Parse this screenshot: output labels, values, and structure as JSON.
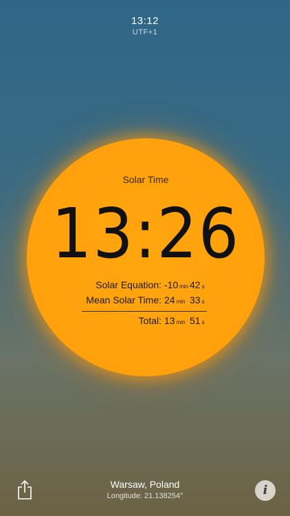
{
  "top": {
    "time": "13:12",
    "timezone": "UTF+1"
  },
  "sun": {
    "label": "Solar Time",
    "time": "13:26",
    "rows": [
      {
        "label": "Solar Equation:",
        "minutes": "-10",
        "min_unit": "min",
        "seconds": "42",
        "sec_unit": "s"
      },
      {
        "label": "Mean Solar Time:",
        "minutes": "24",
        "min_unit": "min",
        "seconds": "33",
        "sec_unit": "s"
      },
      {
        "label": "Total:",
        "minutes": "13",
        "min_unit": "min",
        "seconds": "51",
        "sec_unit": "s"
      }
    ]
  },
  "location": {
    "city": "Warsaw, Poland",
    "longitude": "Longitude: 21.138254°"
  },
  "buttons": {
    "info_label": "i",
    "share_icon": "share-icon"
  },
  "colors": {
    "sun": "#ffa60f",
    "bg_top": "#2f6688",
    "bg_bottom": "#6c6244"
  }
}
